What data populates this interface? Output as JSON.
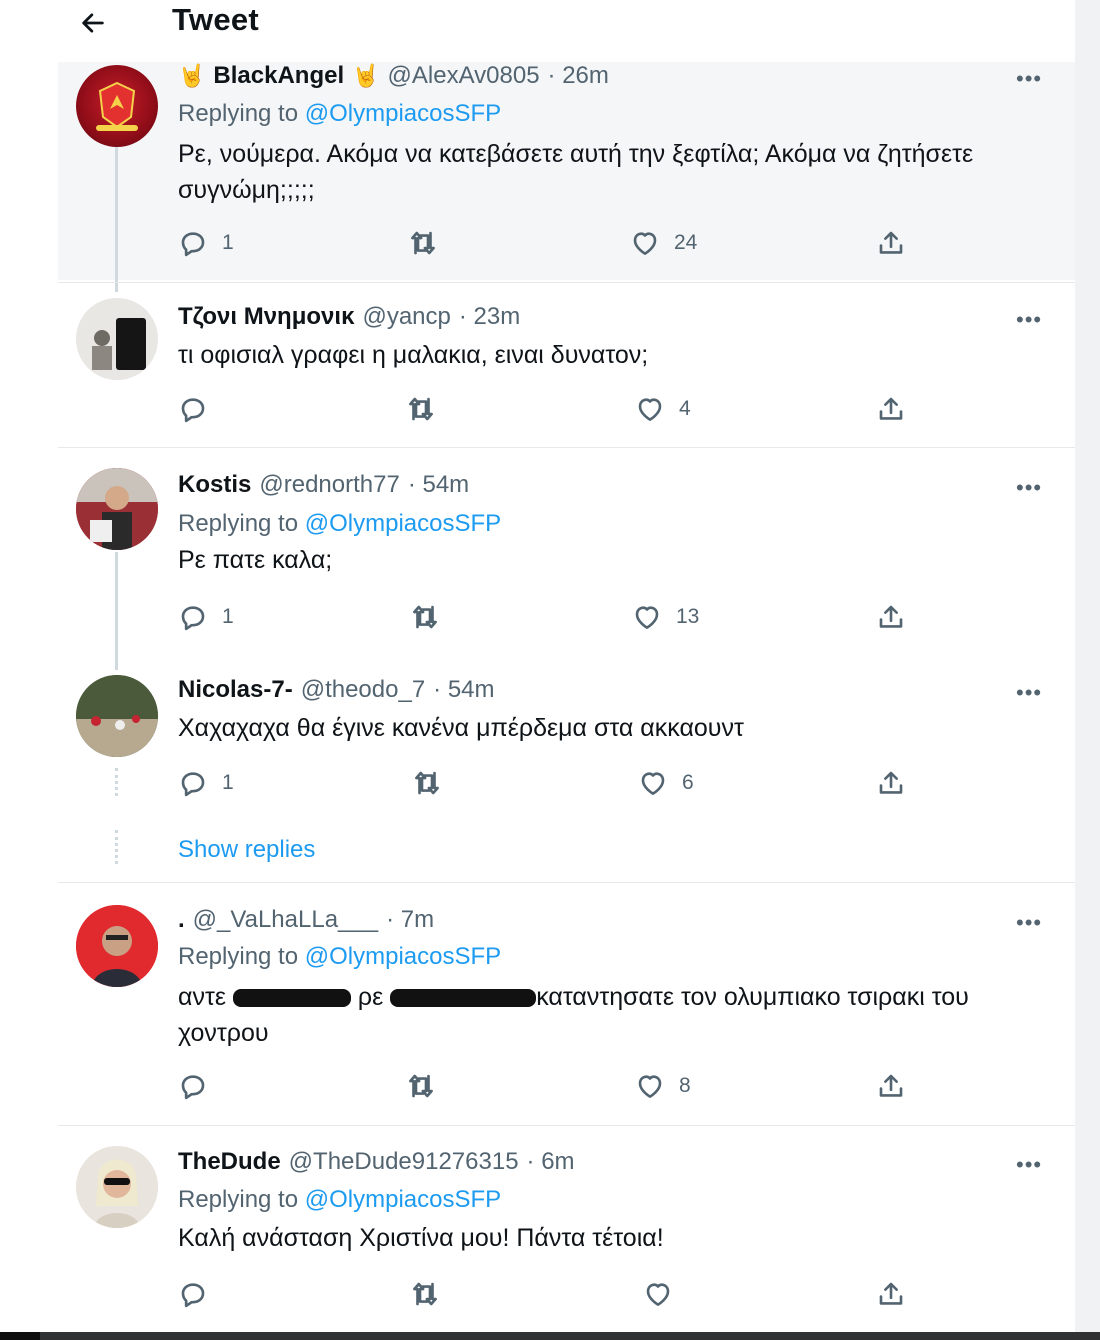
{
  "header": {
    "back_icon": "arrow-left-icon",
    "title": "Tweet"
  },
  "tweets": [
    {
      "name": "BlackAngel",
      "name_emoji": "🤘",
      "handle": "@AlexAv0805",
      "time": "· 26m",
      "replying_prefix": "Replying to",
      "replying_to": "@OlympiacosSFP",
      "text": "Ρε, νούμερα. Ακόμα να κατεβάσετε αυτή την ξεφτίλα; Ακόμα να ζητήσετε συγνώμη;;;;;",
      "replies": "1",
      "retweets": "",
      "likes": "24"
    },
    {
      "name": "Τζονι Μνημονικ",
      "handle": "@yancp",
      "time": "· 23m",
      "text": "τι οφισιαλ γραφει η μαλακια, ειναι δυνατον;",
      "replies": "",
      "retweets": "",
      "likes": "4"
    },
    {
      "name": "Kostis",
      "handle": "@rednorth77",
      "time": "· 54m",
      "replying_prefix": "Replying to",
      "replying_to": "@OlympiacosSFP",
      "text": "Ρε πατε καλα;",
      "replies": "1",
      "retweets": "",
      "likes": "13"
    },
    {
      "name": "Nicolas-7-",
      "handle": "@theodo_7",
      "time": "· 54m",
      "text": "Χαχαχαχα θα έγινε κανένα μπέρδεμα στα ακκαουντ",
      "replies": "1",
      "retweets": "",
      "likes": "6"
    },
    {
      "name": ".",
      "handle": "@_VaLhaLLa___",
      "time": "· 7m",
      "replying_prefix": "Replying to",
      "replying_to": "@OlympiacosSFP",
      "text_part1": "αντε",
      "text_part2": "ρε",
      "text_part3": "καταντησατε τον ολυμπιακο τσιρακι του χοντρου",
      "replies": "",
      "retweets": "",
      "likes": "8"
    },
    {
      "name": "TheDude",
      "handle": "@TheDude91276315",
      "time": "· 6m",
      "replying_prefix": "Replying to",
      "replying_to": "@OlympiacosSFP",
      "text": "Καλή ανάσταση Χριστίνα μου! Πάντα τέτοια!",
      "replies": "",
      "retweets": "",
      "likes": ""
    }
  ],
  "show_replies": "Show replies",
  "more_label": "•••",
  "icons": {
    "reply": "reply-icon",
    "retweet": "retweet-icon",
    "like": "heart-icon",
    "share": "share-icon",
    "more": "more-icon"
  },
  "colors": {
    "link": "#1d9bf0",
    "secondary": "#536471",
    "text": "#0f1419"
  }
}
